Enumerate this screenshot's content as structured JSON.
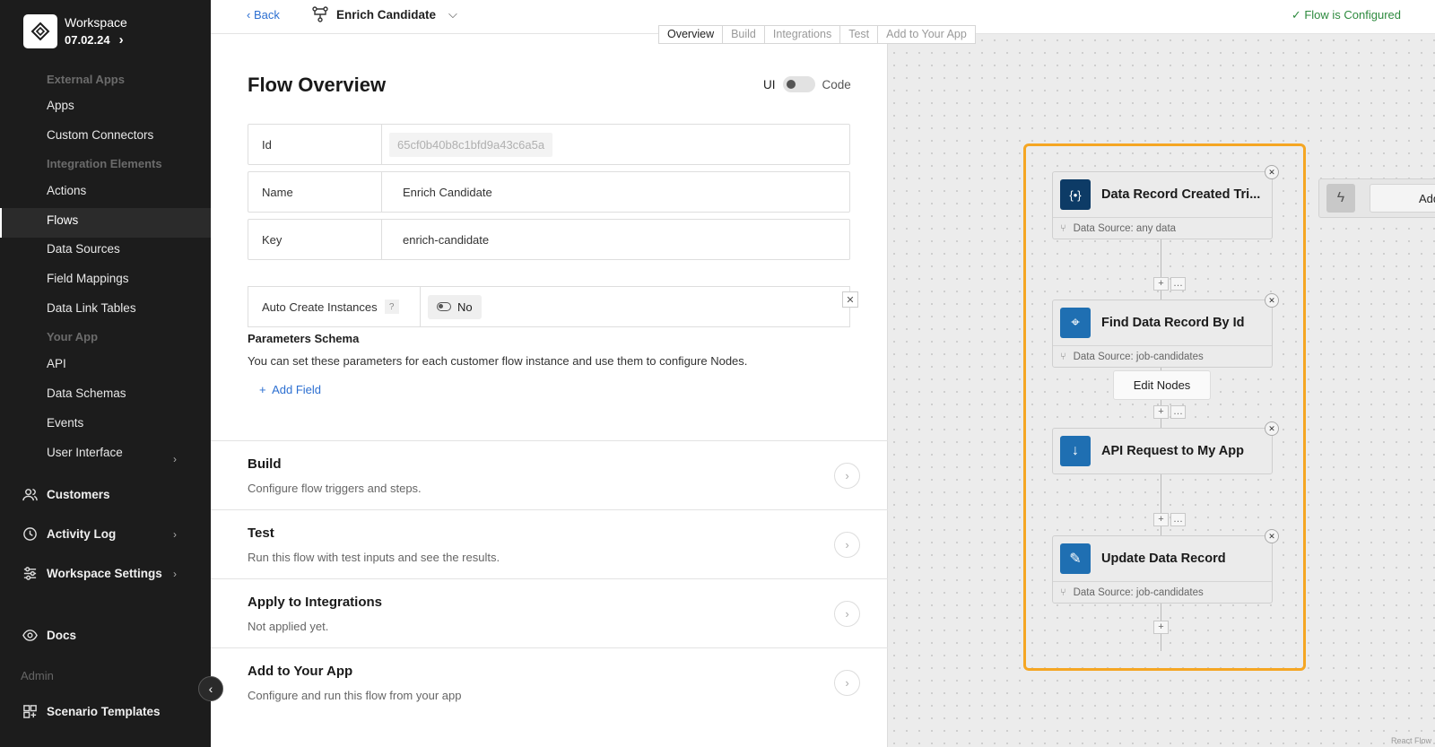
{
  "workspace": {
    "name": "Workspace",
    "version": "07.02.24"
  },
  "sidebar": {
    "sections": [
      {
        "title": "External Apps",
        "items": [
          "Apps",
          "Custom Connectors"
        ]
      },
      {
        "title": "Integration Elements",
        "items": [
          "Actions",
          "Flows",
          "Data Sources",
          "Field Mappings",
          "Data Link Tables"
        ]
      },
      {
        "title": "Your App",
        "items": [
          "API",
          "Data Schemas",
          "Events",
          "User Interface"
        ]
      }
    ],
    "active_item": "Flows",
    "main": {
      "customers": "Customers",
      "activity_log": "Activity Log",
      "workspace_settings": "Workspace Settings",
      "docs": "Docs"
    },
    "admin_title": "Admin",
    "scenario_templates": "Scenario Templates"
  },
  "topbar": {
    "back": "Back",
    "flow_title": "Enrich Candidate",
    "status": "Flow is Configured",
    "tabs": [
      "Overview",
      "Build",
      "Integrations",
      "Test",
      "Add to Your App"
    ],
    "active_tab": "Overview"
  },
  "overview": {
    "title": "Flow Overview",
    "toggle_ui": "UI",
    "toggle_code": "Code",
    "fields": {
      "id_label": "Id",
      "id_value": "65cf0b40b8c1bfd9a43c6a5a",
      "name_label": "Name",
      "name_value": "Enrich Candidate",
      "key_label": "Key",
      "key_value": "enrich-candidate"
    },
    "auto_create": {
      "label": "Auto Create Instances",
      "help": "?",
      "value": "No"
    },
    "params": {
      "title": "Parameters Schema",
      "desc": "You can set these parameters for each customer flow instance and use them to configure Nodes.",
      "add_field": "Add Field"
    },
    "sections": [
      {
        "title": "Build",
        "desc": "Configure flow triggers and steps."
      },
      {
        "title": "Test",
        "desc": "Run this flow with test inputs and see the results."
      },
      {
        "title": "Apply to Integrations",
        "desc": "Not applied yet."
      },
      {
        "title": "Add to Your App",
        "desc": "Configure and run this flow from your app"
      }
    ]
  },
  "canvas": {
    "nodes": [
      {
        "title": "Data Record Created Tri...",
        "icon": "{•}",
        "color": "#0d3b66",
        "footer": "Data Source: any data"
      },
      {
        "title": "Find Data Record By Id",
        "icon": "⌖",
        "color": "#1f6fb2",
        "footer": "Data Source: job-candidates"
      },
      {
        "title": "API Request to My App",
        "icon": "↓",
        "color": "#1f6fb2",
        "footer": ""
      },
      {
        "title": "Update Data Record",
        "icon": "✎",
        "color": "#1f6fb2",
        "footer": "Data Source: job-candidates"
      }
    ],
    "edit_nodes": "Edit Nodes",
    "side_add": "Add",
    "attribution": "React Flow"
  }
}
